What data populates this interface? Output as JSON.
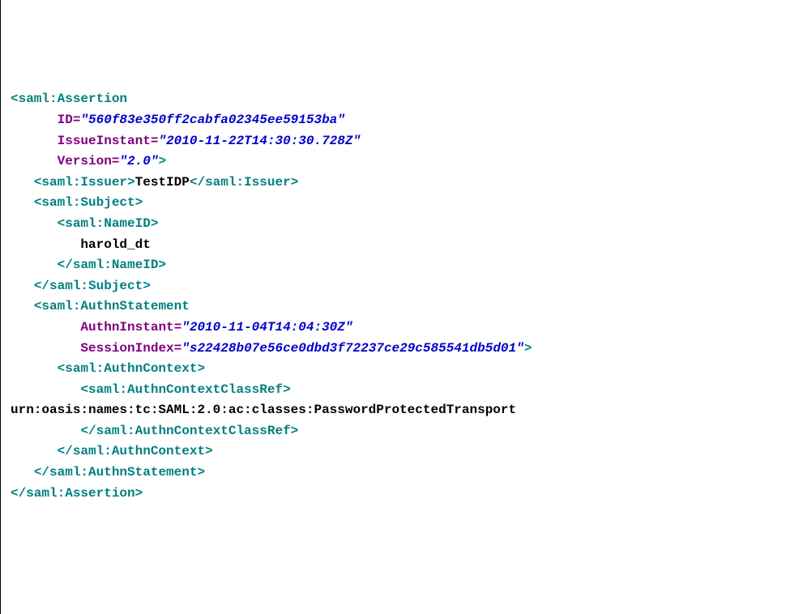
{
  "tokens": [
    {
      "t": "tag",
      "v": "<saml:Assertion"
    },
    {
      "t": "nl"
    },
    {
      "t": "sp",
      "v": "      "
    },
    {
      "t": "attr",
      "v": "ID="
    },
    {
      "t": "val",
      "v": "\"560f83e350ff2cabfa02345ee59153ba\""
    },
    {
      "t": "nl"
    },
    {
      "t": "sp",
      "v": "      "
    },
    {
      "t": "attr",
      "v": "IssueInstant="
    },
    {
      "t": "val",
      "v": "\"2010-11-22T14:30:30.728Z\""
    },
    {
      "t": "nl"
    },
    {
      "t": "sp",
      "v": "      "
    },
    {
      "t": "attr",
      "v": "Version="
    },
    {
      "t": "val",
      "v": "\"2.0\""
    },
    {
      "t": "tag",
      "v": ">"
    },
    {
      "t": "nl"
    },
    {
      "t": "sp",
      "v": "   "
    },
    {
      "t": "tag",
      "v": "<saml:Issuer>"
    },
    {
      "t": "text",
      "v": "TestIDP"
    },
    {
      "t": "tag",
      "v": "</saml:Issuer>"
    },
    {
      "t": "nl"
    },
    {
      "t": "sp",
      "v": "   "
    },
    {
      "t": "tag",
      "v": "<saml:Subject>"
    },
    {
      "t": "nl"
    },
    {
      "t": "sp",
      "v": "      "
    },
    {
      "t": "tag",
      "v": "<saml:NameID>"
    },
    {
      "t": "nl"
    },
    {
      "t": "sp",
      "v": "         "
    },
    {
      "t": "text",
      "v": "harold_dt"
    },
    {
      "t": "nl"
    },
    {
      "t": "sp",
      "v": "      "
    },
    {
      "t": "tag",
      "v": "</saml:NameID>"
    },
    {
      "t": "nl"
    },
    {
      "t": "sp",
      "v": "   "
    },
    {
      "t": "tag",
      "v": "</saml:Subject>"
    },
    {
      "t": "nl"
    },
    {
      "t": "sp",
      "v": "   "
    },
    {
      "t": "tag",
      "v": "<saml:AuthnStatement"
    },
    {
      "t": "nl"
    },
    {
      "t": "sp",
      "v": "         "
    },
    {
      "t": "attr",
      "v": "AuthnInstant="
    },
    {
      "t": "val",
      "v": "\"2010-11-04T14:04:30Z\""
    },
    {
      "t": "nl"
    },
    {
      "t": "sp",
      "v": "         "
    },
    {
      "t": "attr",
      "v": "SessionIndex="
    },
    {
      "t": "val",
      "v": "\"s22428b07e56ce0dbd3f72237ce29c585541db5d01\""
    },
    {
      "t": "tag",
      "v": ">"
    },
    {
      "t": "nl"
    },
    {
      "t": "sp",
      "v": "      "
    },
    {
      "t": "tag",
      "v": "<saml:AuthnContext>"
    },
    {
      "t": "nl"
    },
    {
      "t": "sp",
      "v": "         "
    },
    {
      "t": "tag",
      "v": "<saml:AuthnContextClassRef>"
    },
    {
      "t": "nl"
    },
    {
      "t": "text",
      "v": "urn:oasis:names:tc:SAML:2.0:ac:classes:PasswordProtectedTransport"
    },
    {
      "t": "nl"
    },
    {
      "t": "sp",
      "v": "         "
    },
    {
      "t": "tag",
      "v": "</saml:AuthnContextClassRef>"
    },
    {
      "t": "nl"
    },
    {
      "t": "sp",
      "v": "      "
    },
    {
      "t": "tag",
      "v": "</saml:AuthnContext>"
    },
    {
      "t": "nl"
    },
    {
      "t": "sp",
      "v": "   "
    },
    {
      "t": "tag",
      "v": "</saml:AuthnStatement>"
    },
    {
      "t": "nl"
    },
    {
      "t": "tag",
      "v": "</saml:Assertion>"
    }
  ]
}
